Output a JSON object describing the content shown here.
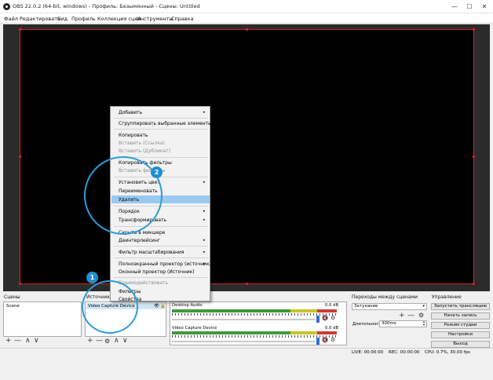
{
  "window": {
    "title": "OBS 22.0.2 (64-bit, windows) - Профиль: Безымянный - Сцены: Untitled",
    "minimize": "—",
    "maximize": "☐",
    "close": "✕"
  },
  "menubar": [
    "Файл",
    "Редактировать",
    "Вид",
    "Профиль",
    "Коллекция сцен",
    "Инструменты",
    "Справка"
  ],
  "docks": {
    "scenes": "Сцены",
    "sources": "Источник",
    "transitions": "Переходы между сценами",
    "controls": "Управление"
  },
  "scenes": {
    "items": [
      "Scene"
    ]
  },
  "sources": {
    "items": [
      "Video Capture Device"
    ]
  },
  "toolbar_glyphs": {
    "add": "+",
    "remove": "—",
    "up": "∧",
    "down": "∨",
    "gear": "⚙"
  },
  "mixer": {
    "channels": [
      {
        "name": "Desktop Audio",
        "level": "0.0 dB"
      },
      {
        "name": "Video Capture Device",
        "level": "0.0 dB"
      }
    ]
  },
  "transitions": {
    "type": "Затухание",
    "duration_label": "Длительность",
    "duration_value": "300ms"
  },
  "controls": {
    "buttons": [
      "Запустить трансляцию",
      "Начать запись",
      "Режим студии",
      "Настройки",
      "Выход"
    ]
  },
  "statusbar": {
    "live": "LIVE: 00:00:00",
    "rec": "REC: 00:00:00",
    "cpu": "CPU: 0.7%, 30.00 fps"
  },
  "context_menu": {
    "items": [
      {
        "label": "Добавить",
        "submenu": true
      },
      {
        "label": "Сгруппировать выбранные элементы"
      },
      {
        "label": "Копировать"
      },
      {
        "label": "Вставить (Ссылка)",
        "disabled": true
      },
      {
        "label": "Вставить (Дубликат)",
        "disabled": true
      },
      {
        "label": "Копировать фильтры"
      },
      {
        "label": "Вставить фильтры",
        "disabled": true
      },
      {
        "label": "Установить цвет",
        "submenu": true
      },
      {
        "label": "Переименовать"
      },
      {
        "label": "Удалить",
        "highlighted": true
      },
      {
        "label": "Порядок",
        "submenu": true
      },
      {
        "label": "Трансформировать",
        "submenu": true
      },
      {
        "label": "Скрыть в микшере"
      },
      {
        "label": "Деинтерлейсинг",
        "submenu": true
      },
      {
        "label": "Фильтр масштабирования",
        "submenu": true
      },
      {
        "label": "Полноэкранный проектор (источник)",
        "submenu": true
      },
      {
        "label": "Оконный проектор (Источник)"
      },
      {
        "label": "Взаимодействовать",
        "disabled": true
      },
      {
        "label": "Фильтры"
      },
      {
        "label": "Свойства"
      }
    ],
    "submenu_arrow": "▸"
  },
  "annotations": [
    "1",
    "2"
  ],
  "colors": {
    "accent": "#2d9cdb",
    "preview_border": "#d21f2d",
    "highlight": "#99c9ef"
  }
}
